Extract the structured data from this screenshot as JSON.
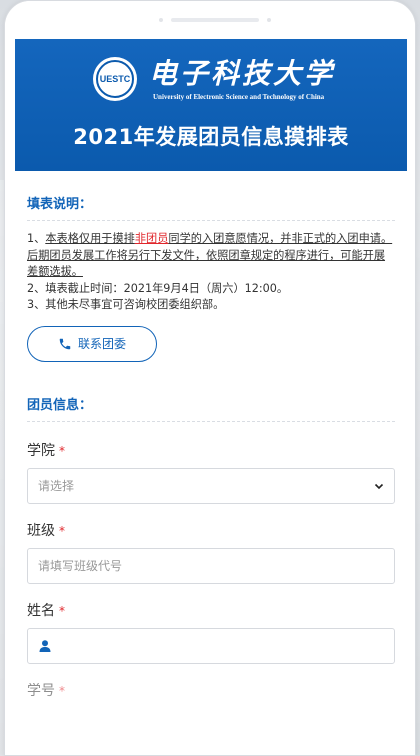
{
  "header": {
    "uni_name_cn": "电子科技大学",
    "uni_name_en": "University of Electronic Science and Technology of China",
    "emblem_text": "UESTC",
    "page_title": "2021年发展团员信息摸排表"
  },
  "instructions": {
    "title": "填表说明：",
    "line1_prefix": "1、",
    "line1_u1": "本表格仅用于摸排",
    "line1_red": "非团员",
    "line1_u2": "同学的入团意愿情况，并非正式的入团申请。后期团员发展工作将另行下发文件，依照团章规定的程序进行，可能开展差额选拔。",
    "line2": "2、填表截止时间：2021年9月4日（周六）12:00。",
    "line3": "3、其他未尽事宜可咨询校团委组织部。",
    "contact_button": "联系团委"
  },
  "member_info": {
    "title": "团员信息：",
    "fields": [
      {
        "label": "学院",
        "required": "*",
        "placeholder": "请选择"
      },
      {
        "label": "班级",
        "required": "*",
        "placeholder": "请填写班级代号"
      },
      {
        "label": "姓名",
        "required": "*",
        "placeholder": ""
      },
      {
        "label": "学号",
        "required": "*"
      }
    ]
  },
  "colors": {
    "brand_blue": "#0b5aad",
    "required_red": "#e0262b"
  },
  "icons": {
    "contact": "phone-icon",
    "select": "chevron-down-icon",
    "name": "user-icon"
  }
}
